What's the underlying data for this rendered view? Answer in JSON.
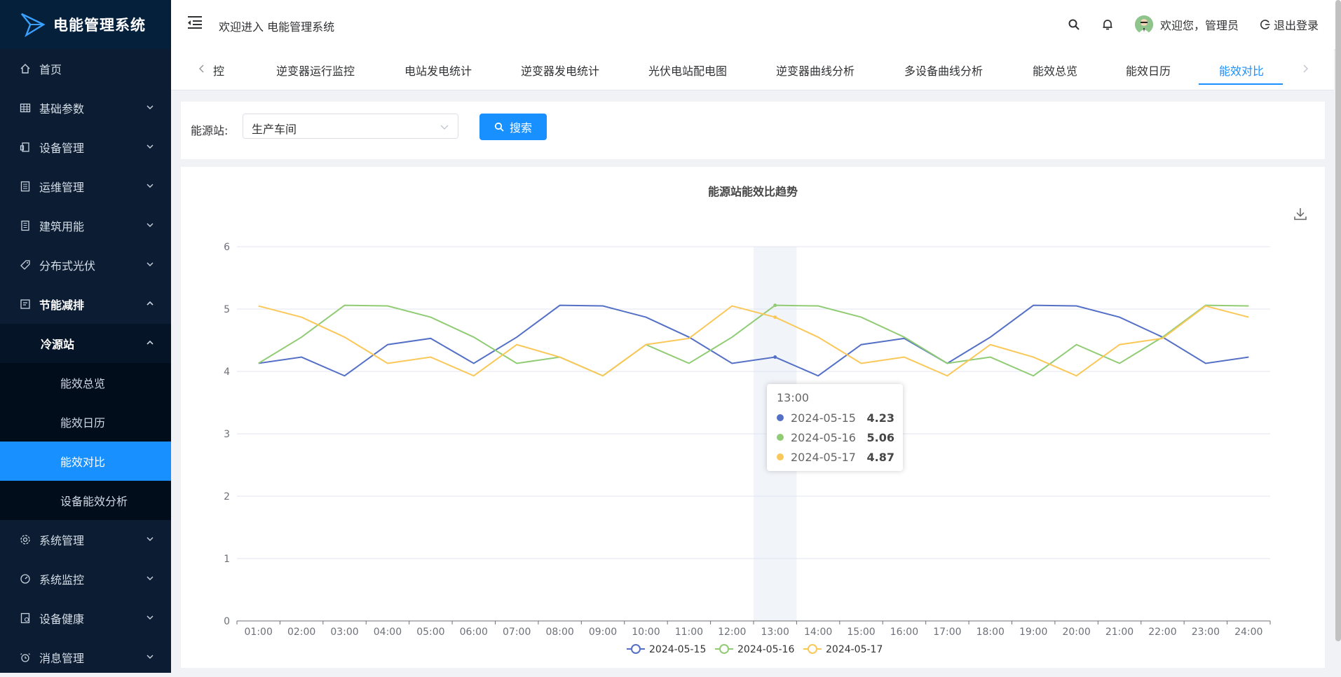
{
  "app": {
    "title": "电能管理系统"
  },
  "sidebar": {
    "items": [
      {
        "label": "首页",
        "icon": "home-icon"
      },
      {
        "label": "基础参数",
        "icon": "table-icon"
      },
      {
        "label": "设备管理",
        "icon": "device-icon"
      },
      {
        "label": "运维管理",
        "icon": "list-icon"
      },
      {
        "label": "建筑用能",
        "icon": "building-icon"
      },
      {
        "label": "分布式光伏",
        "icon": "tag-icon"
      },
      {
        "label": "节能减排",
        "icon": "eco-icon"
      }
    ],
    "sub_group": "冷源站",
    "sub_items": [
      "能效总览",
      "能效日历",
      "能效对比",
      "设备能效分析"
    ],
    "bottom_items": [
      {
        "label": "系统管理",
        "icon": "gear-icon"
      },
      {
        "label": "系统监控",
        "icon": "gauge-icon"
      },
      {
        "label": "设备健康",
        "icon": "health-icon"
      },
      {
        "label": "消息管理",
        "icon": "alarm-icon"
      }
    ]
  },
  "header": {
    "welcome": "欢迎进入 电能管理系统",
    "user": "欢迎您，管理员",
    "logout": "退出登录"
  },
  "tabs": {
    "items": [
      "控",
      "逆变器运行监控",
      "电站发电统计",
      "逆变器发电统计",
      "光伏电站配电图",
      "逆变器曲线分析",
      "多设备曲线分析",
      "能效总览",
      "能效日历",
      "能效对比"
    ],
    "active": "能效对比"
  },
  "filter": {
    "label": "能源站:",
    "selected": "生产车间",
    "search_label": "搜索"
  },
  "tooltip": {
    "time": "13:00",
    "rows": [
      {
        "name": "2024-05-15",
        "value": "4.23",
        "color": "#5470c6"
      },
      {
        "name": "2024-05-16",
        "value": "5.06",
        "color": "#91cc75"
      },
      {
        "name": "2024-05-17",
        "value": "4.87",
        "color": "#fac858"
      }
    ]
  },
  "chart_data": {
    "type": "line",
    "title": "能源站能效比趋势",
    "x": [
      "01:00",
      "02:00",
      "03:00",
      "04:00",
      "05:00",
      "06:00",
      "07:00",
      "08:00",
      "09:00",
      "10:00",
      "11:00",
      "12:00",
      "13:00",
      "14:00",
      "15:00",
      "16:00",
      "17:00",
      "18:00",
      "19:00",
      "20:00",
      "21:00",
      "22:00",
      "23:00",
      "24:00"
    ],
    "ylim": [
      0,
      6
    ],
    "yticks": [
      0,
      1,
      2,
      3,
      4,
      5,
      6
    ],
    "grid": true,
    "legend": "bottom-center",
    "highlight_x": "13:00",
    "series": [
      {
        "name": "2024-05-15",
        "color": "#5470c6",
        "values": [
          4.13,
          4.23,
          3.93,
          4.43,
          4.53,
          4.13,
          4.55,
          5.06,
          5.05,
          4.87,
          4.55,
          4.13,
          4.23,
          3.93,
          4.43,
          4.53,
          4.13,
          4.55,
          5.06,
          5.05,
          4.87,
          4.55,
          4.13,
          4.23
        ]
      },
      {
        "name": "2024-05-16",
        "color": "#91cc75",
        "values": [
          4.13,
          4.55,
          5.06,
          5.05,
          4.87,
          4.55,
          4.13,
          4.23,
          3.93,
          4.43,
          4.13,
          4.55,
          5.06,
          5.05,
          4.87,
          4.55,
          4.13,
          4.23,
          3.93,
          4.43,
          4.13,
          4.55,
          5.06,
          5.05
        ]
      },
      {
        "name": "2024-05-17",
        "color": "#fac858",
        "values": [
          5.05,
          4.87,
          4.55,
          4.13,
          4.23,
          3.93,
          4.43,
          4.23,
          3.93,
          4.43,
          4.53,
          5.05,
          4.87,
          4.55,
          4.13,
          4.23,
          3.93,
          4.43,
          4.23,
          3.93,
          4.43,
          4.53,
          5.05,
          4.87
        ]
      }
    ]
  }
}
